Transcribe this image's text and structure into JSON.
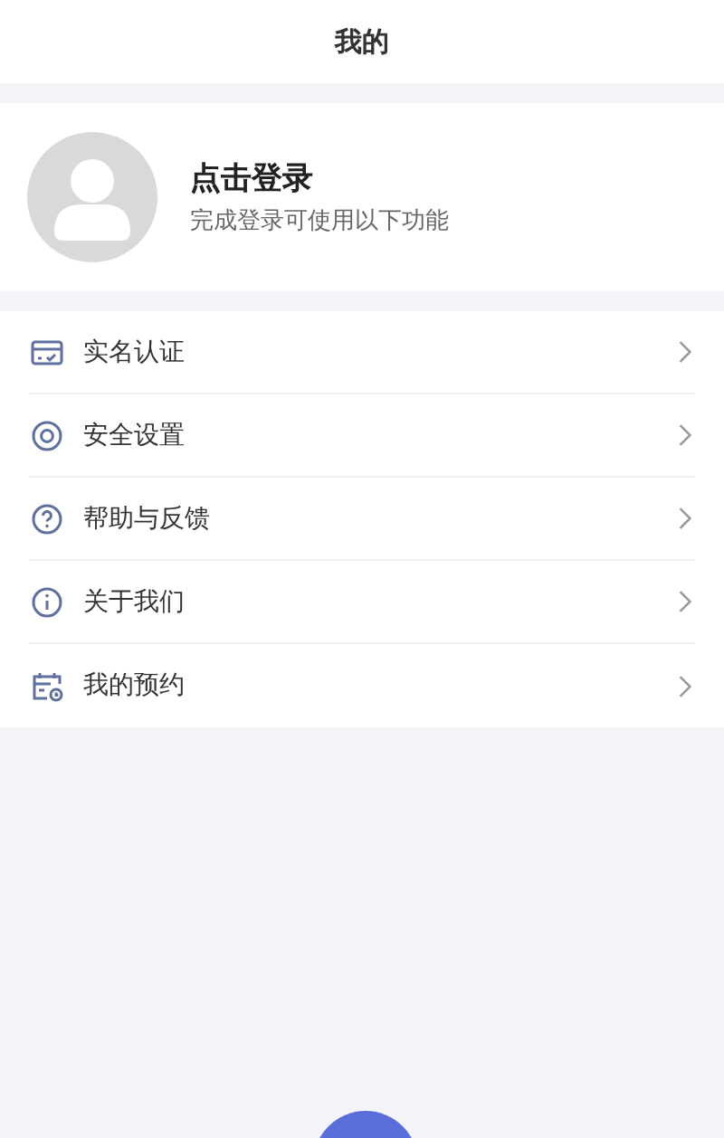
{
  "header": {
    "title": "我的"
  },
  "profile": {
    "name": "点击登录",
    "subtitle": "完成登录可使用以下功能"
  },
  "menu": [
    {
      "label": "实名认证",
      "kind": "card"
    },
    {
      "label": "安全设置",
      "kind": "target"
    },
    {
      "label": "帮助与反馈",
      "kind": "question"
    },
    {
      "label": "关于我们",
      "kind": "info"
    },
    {
      "label": "我的预约",
      "kind": "calendar"
    }
  ]
}
